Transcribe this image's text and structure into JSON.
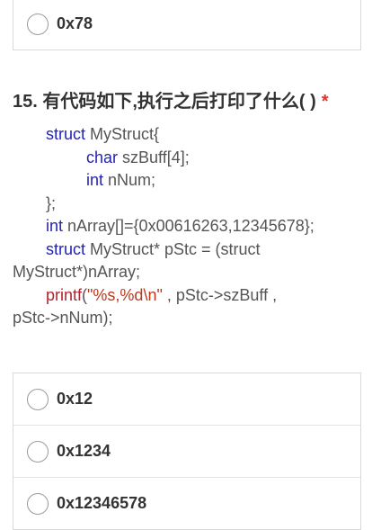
{
  "previous_question": {
    "last_option": "0x78"
  },
  "question": {
    "title": "15. 有代码如下,执行之后打印了什么( )",
    "required_mark": "*",
    "code": {
      "l1_kw": "struct",
      "l1_rest": " MyStruct{",
      "l2_kw": "char",
      "l2_rest": " szBuff[4];",
      "l3_kw": "int",
      "l3_rest": " nNum;",
      "l4": "};",
      "l5_kw": "int",
      "l5_rest": " nArray[]={0x00616263,12345678};",
      "l6_kw": "struct",
      "l6_rest": " MyStruct* pStc = (struct",
      "l7": "MyStruct*)nArray;",
      "l8_fn": "printf",
      "l8_paren": "(",
      "l8_str": "\"%s,%d\\n\"",
      "l8_rest": " , pStc->szBuff ,",
      "l9": "pStc->nNum);"
    },
    "options": [
      {
        "label": "0x12"
      },
      {
        "label": "0x1234"
      },
      {
        "label": "0x12346578"
      }
    ]
  },
  "colors": {
    "keyword": "#2424b0",
    "function": "#b0242f",
    "string": "#b83a1e",
    "required": "#e0322f",
    "border": "#d9d9d9"
  }
}
